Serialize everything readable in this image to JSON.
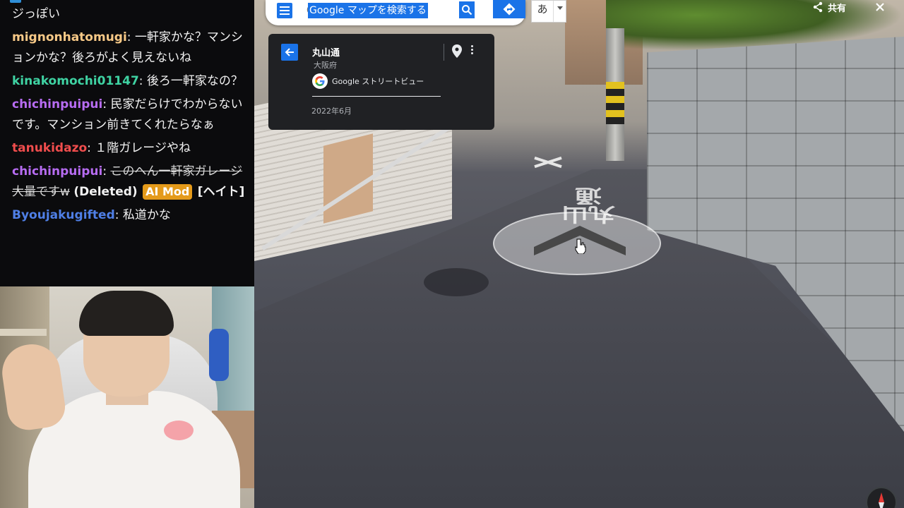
{
  "chat": {
    "messages": [
      {
        "user": "",
        "user_color": "#f2f2f2",
        "text": "ジっぽい"
      },
      {
        "user": "mignonhatomugi",
        "user_color": "#f7c987",
        "text": "一軒家かな？マンションかな？後ろがよく見えないね"
      },
      {
        "user": "kinakomochi01147",
        "user_color": "#3fd3a3",
        "text": "後ろ一軒家なの？"
      },
      {
        "user": "chichinpuipui",
        "user_color": "#b76cf2",
        "text": "民家だらけでわからないです。マンション前きてくれたらなぁ"
      },
      {
        "user": "tanukidazo",
        "user_color": "#f04d4d",
        "text": "１階ガレージやね"
      },
      {
        "user": "chichinpuipui",
        "user_color": "#b76cf2",
        "deleted_text": "このへん一軒家ガレージ大量ですw",
        "deleted_label": "(Deleted)",
        "badge": "AI Mod",
        "tag": "[ヘイト]"
      },
      {
        "user": "Byoujakugifted",
        "user_color": "#4f7fe6",
        "text": "私道かな"
      }
    ]
  },
  "maps": {
    "search": {
      "placeholder": "Google マップを検索する"
    },
    "ime": {
      "char": "あ"
    },
    "card": {
      "title": "丸山通",
      "subtitle": "大阪府",
      "brand": "Google ストリートビュー",
      "date": "2022年6月"
    },
    "share_label": "共有",
    "road_marking": "丸山通",
    "colors": {
      "accent": "#1a73e8",
      "card_bg": "#202124"
    }
  }
}
